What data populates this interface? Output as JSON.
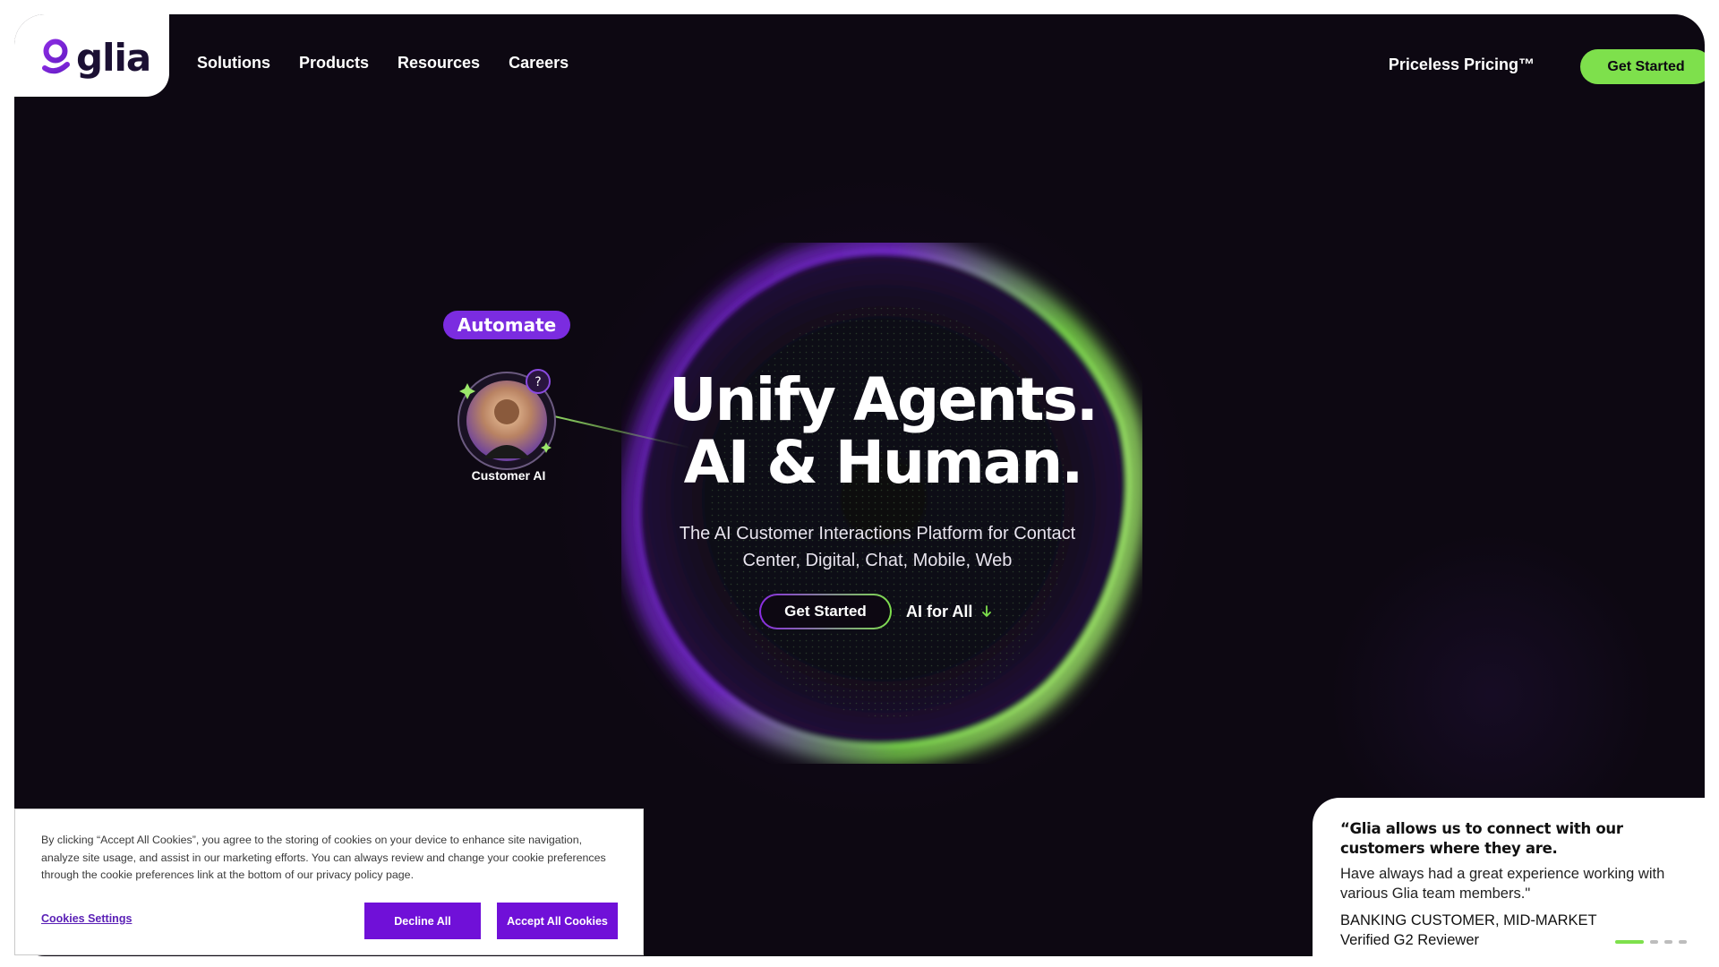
{
  "brand": {
    "name": "glia"
  },
  "nav": {
    "items": [
      "Solutions",
      "Products",
      "Resources",
      "Careers"
    ],
    "pricing": "Priceless Pricing™",
    "cta": "Get Started"
  },
  "hero": {
    "headline_line1": "Unify Agents.",
    "headline_line2": "AI & Human.",
    "subtitle": "The AI Customer Interactions Platform for Contact Center, Digital, Chat, Mobile, Web",
    "cta_primary": "Get Started",
    "cta_secondary": "AI for All",
    "automate_label": "Automate",
    "avatar_label": "Customer AI"
  },
  "cookie": {
    "text": "By clicking “Accept All Cookies”, you agree to the storing of cookies on your device to enhance site navigation, analyze site usage, and assist in our marketing efforts. You can always review and change your cookie preferences through the cookie preferences link at the bottom of our privacy policy page.",
    "settings_label": "Cookies Settings",
    "decline_label": "Decline All",
    "accept_label": "Accept All Cookies"
  },
  "testimonial": {
    "quote": "“Glia allows us to connect with our customers where they are.",
    "body": "Have always had a great experience working with various Glia team members.\"",
    "who": "BANKING CUSTOMER, MID-MARKET",
    "source": "Verified G2 Reviewer",
    "slides_total": 4,
    "slide_active": 1
  },
  "colors": {
    "accent_green": "#7ee04c",
    "accent_purple": "#7b2ce0",
    "hero_bg": "#0d0812"
  },
  "icons": [
    "glia-logo-icon",
    "arrow-down-icon",
    "chat-question-icon",
    "sparkle-icon"
  ]
}
